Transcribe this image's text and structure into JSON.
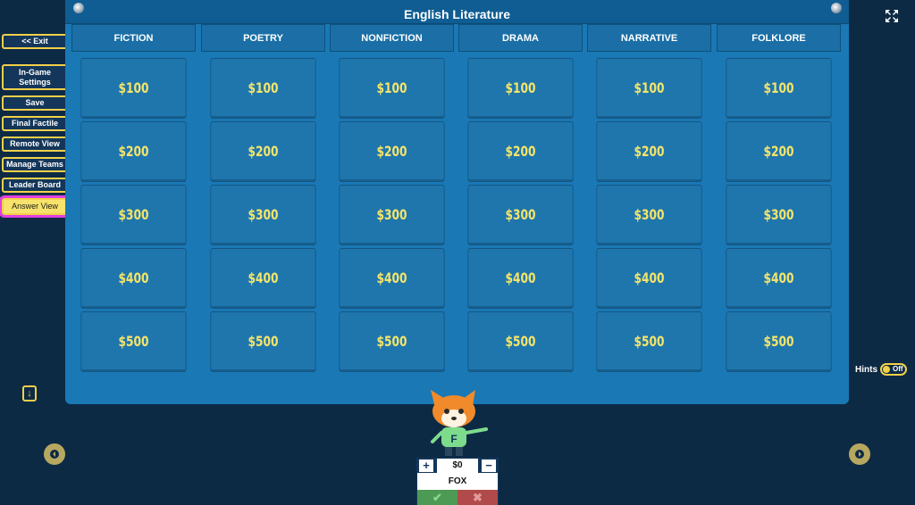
{
  "board": {
    "title": "English Literature",
    "categories": [
      "FICTION",
      "POETRY",
      "NONFICTION",
      "DRAMA",
      "NARRATIVE",
      "FOLKLORE"
    ],
    "values": [
      "$100",
      "$200",
      "$300",
      "$400",
      "$500"
    ]
  },
  "sidebar": {
    "exit": "<< Exit",
    "settings": "In-Game Settings",
    "save": "Save",
    "final": "Final Factile",
    "remote": "Remote View",
    "teams": "Manage Teams",
    "leader": "Leader Board",
    "answer": "Answer View"
  },
  "hints": {
    "label": "Hints",
    "state": "Off"
  },
  "team": {
    "name": "FOX",
    "score": "$0",
    "avatar_letter": "F",
    "plus": "+",
    "minus": "−",
    "correct": "✔",
    "wrong": "✖"
  },
  "colors": {
    "accent": "#f2d04a",
    "board": "#1a78b5",
    "highlight": "#e040e0"
  }
}
